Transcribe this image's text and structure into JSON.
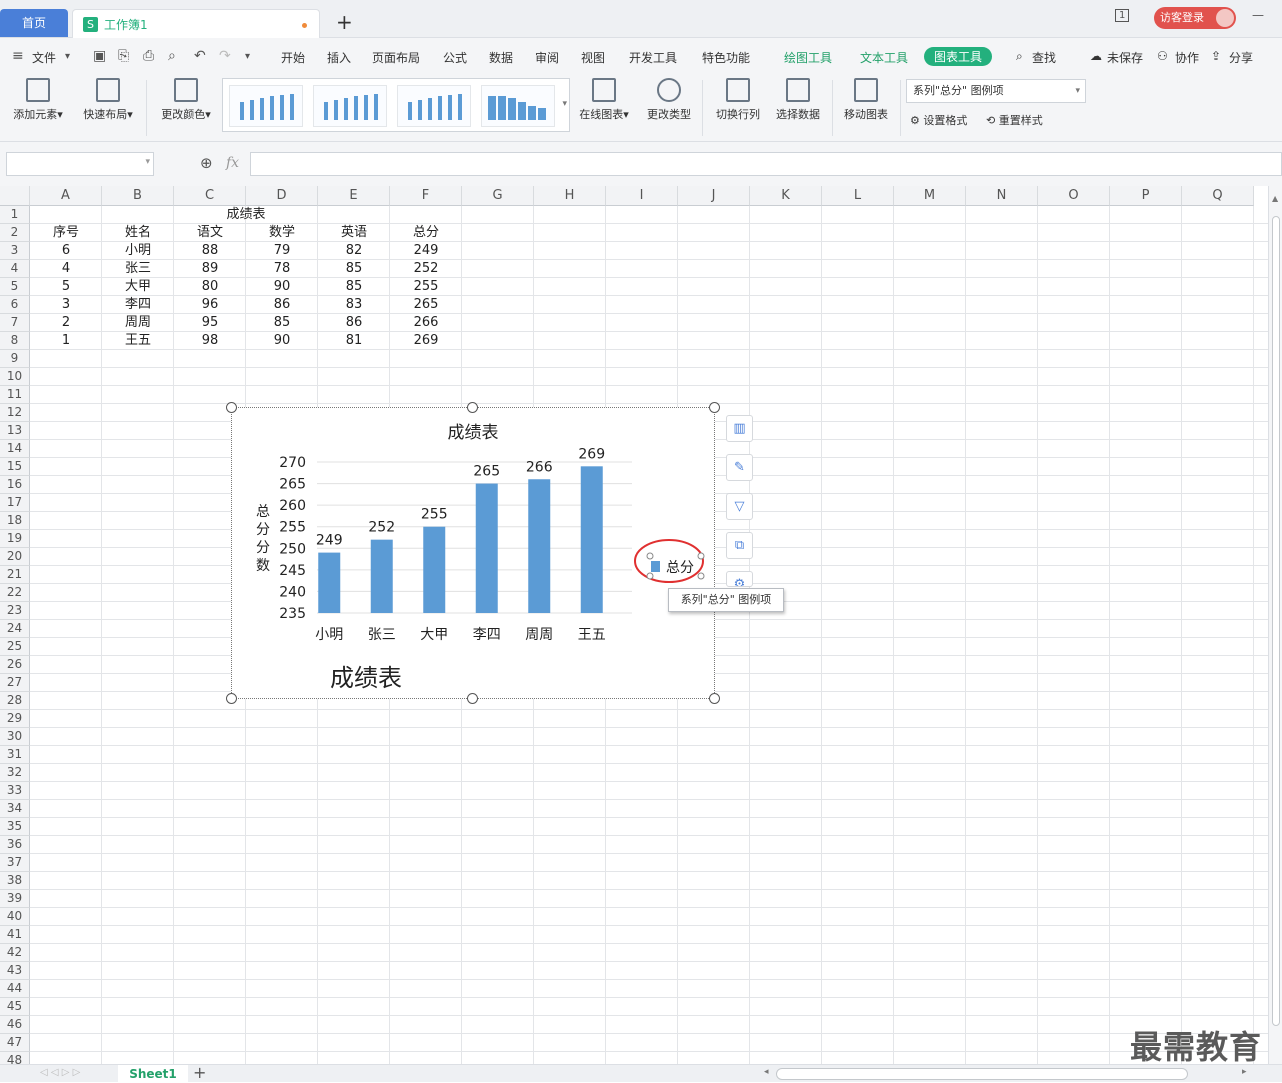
{
  "tabs": {
    "home": "首页",
    "doc_icon": "S",
    "doc": "工作簿1",
    "add": "+"
  },
  "titlebar": {
    "page_indicator": "1",
    "login": "访客登录",
    "minimize": "—"
  },
  "menu": {
    "file": "文件",
    "items": [
      "开始",
      "插入",
      "页面布局",
      "公式",
      "数据",
      "审阅",
      "视图",
      "开发工具",
      "特色功能"
    ],
    "tool_tabs": [
      "绘图工具",
      "文本工具"
    ],
    "active_tab": "图表工具",
    "search": "查找",
    "right": [
      "未保存",
      "协作",
      "分享"
    ]
  },
  "ribbon": {
    "add_element": "添加元素",
    "quick_layout": "快速布局",
    "change_color": "更改颜色",
    "online_chart": "在线图表",
    "change_type": "更改类型",
    "switch_rowcol": "切换行列",
    "select_data": "选择数据",
    "move_chart": "移动图表",
    "element_select": "系列\"总分\" 图例项",
    "set_format": "设置格式",
    "reset_style": "重置样式"
  },
  "formula": {
    "fx": "fx",
    "value": ""
  },
  "columns": [
    "A",
    "B",
    "C",
    "D",
    "E",
    "F",
    "G",
    "H",
    "I",
    "J",
    "K",
    "L",
    "M",
    "N",
    "O",
    "P",
    "Q"
  ],
  "rows_count": 48,
  "sheet": {
    "title": "成绩表",
    "headers": [
      "序号",
      "姓名",
      "语文",
      "数学",
      "英语",
      "总分"
    ],
    "rows": [
      [
        "6",
        "小明",
        "88",
        "79",
        "82",
        "249"
      ],
      [
        "4",
        "张三",
        "89",
        "78",
        "85",
        "252"
      ],
      [
        "5",
        "大甲",
        "80",
        "90",
        "85",
        "255"
      ],
      [
        "3",
        "李四",
        "96",
        "86",
        "83",
        "265"
      ],
      [
        "2",
        "周周",
        "95",
        "85",
        "86",
        "266"
      ],
      [
        "1",
        "王五",
        "98",
        "90",
        "81",
        "269"
      ]
    ]
  },
  "chart_data": {
    "type": "bar",
    "title": "成绩表",
    "categories": [
      "小明",
      "张三",
      "大甲",
      "李四",
      "周周",
      "王五"
    ],
    "series": [
      {
        "name": "总分",
        "values": [
          249,
          252,
          255,
          265,
          266,
          269
        ],
        "color": "#5b9bd5"
      }
    ],
    "ylabel": "总分分数",
    "ylim": [
      235,
      270
    ],
    "yticks": [
      270,
      265,
      260,
      255,
      250,
      245,
      240,
      235
    ],
    "bottom_text": "成绩表",
    "legend_position": "right",
    "data_labels": true
  },
  "tooltip": "系列\"总分\" 图例项",
  "sheet_tabs": {
    "active": "Sheet1",
    "add": "+"
  },
  "watermark": "最需教育"
}
